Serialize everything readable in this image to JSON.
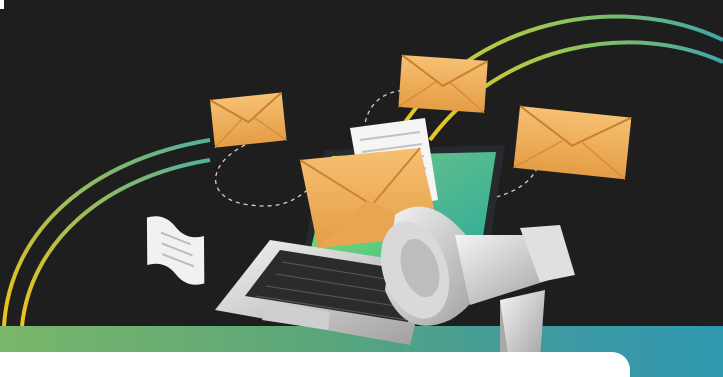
{
  "scene": {
    "subject": "email-marketing-illustration",
    "colors": {
      "background": "#1e1e1e",
      "envelope": "#f0b25a",
      "envelope_dark": "#d8913a",
      "arc_yellow": "#f2c318",
      "arc_teal": "#4fb39a",
      "screen_green": "#58d17a",
      "band_left": "#7ab66a",
      "band_right": "#2f97b0",
      "card": "#ffffff"
    },
    "icons": [
      "laptop-icon",
      "envelope-icon",
      "megaphone-icon",
      "document-icon"
    ]
  }
}
